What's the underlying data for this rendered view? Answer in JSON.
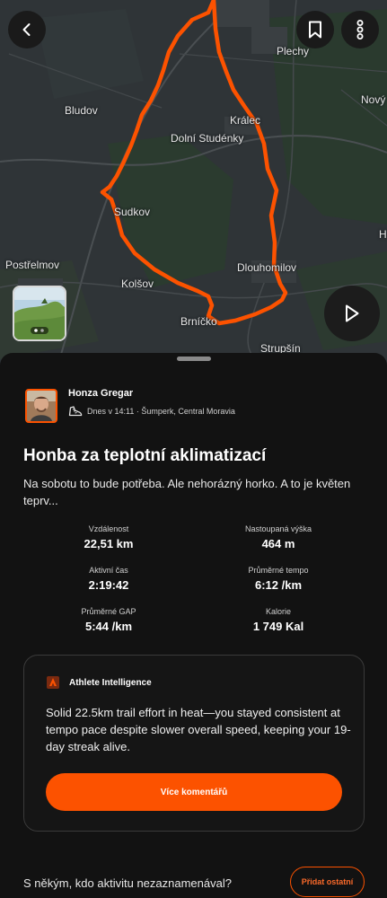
{
  "map": {
    "places": [
      {
        "id": "plechy",
        "name": "Plechy"
      },
      {
        "id": "novy",
        "name": "Nový"
      },
      {
        "id": "bludov",
        "name": "Bludov"
      },
      {
        "id": "kralec",
        "name": "Králec"
      },
      {
        "id": "dolni-studenky",
        "name": "Dolní Studénky"
      },
      {
        "id": "sudkov",
        "name": "Sudkov"
      },
      {
        "id": "postrelmov",
        "name": "Postřelmov"
      },
      {
        "id": "dlouhomilov",
        "name": "Dlouhomilov"
      },
      {
        "id": "kolsov",
        "name": "Kolšov"
      },
      {
        "id": "brnicko",
        "name": "Brníčko"
      },
      {
        "id": "strupsin",
        "name": "Strupšín"
      },
      {
        "id": "h",
        "name": "H"
      }
    ],
    "route_color": "#fc5200"
  },
  "icons": {
    "back": "chevron-left-icon",
    "bookmark": "bookmark-icon",
    "more": "more-vertical-icon",
    "play": "play-icon",
    "shoe": "running-shoe-icon",
    "ai": "athlete-intelligence-icon"
  },
  "activity": {
    "athlete_name": "Honza Gregar",
    "meta": "Dnes v 14:11 · Šumperk, Central Moravia",
    "title": "Honba za teplotní aklimatizací",
    "description": "Na sobotu to bude potřeba. Ale nehorázný horko. A to je květen teprv...",
    "stats": [
      {
        "label": "Vzdálenost",
        "value": "22,51 km"
      },
      {
        "label": "Nastoupaná výška",
        "value": "464 m"
      },
      {
        "label": "Aktivní čas",
        "value": "2:19:42"
      },
      {
        "label": "Průměrné tempo",
        "value": "6:12 /km"
      },
      {
        "label": "Průměrné GAP",
        "value": "5:44 /km"
      },
      {
        "label": "Kalorie",
        "value": "1 749 Kal"
      }
    ]
  },
  "ai": {
    "title": "Athlete Intelligence",
    "text": "Solid 22.5km trail effort in heat—you stayed consistent at tempo pace despite slower overall speed, keeping your 19-day streak alive.",
    "button": "Více komentářů"
  },
  "tag": {
    "question": "S někým, kdo aktivitu nezaznamenával?",
    "button": "Přidat ostatní"
  },
  "colors": {
    "accent": "#fc5200",
    "background": "#121212"
  }
}
